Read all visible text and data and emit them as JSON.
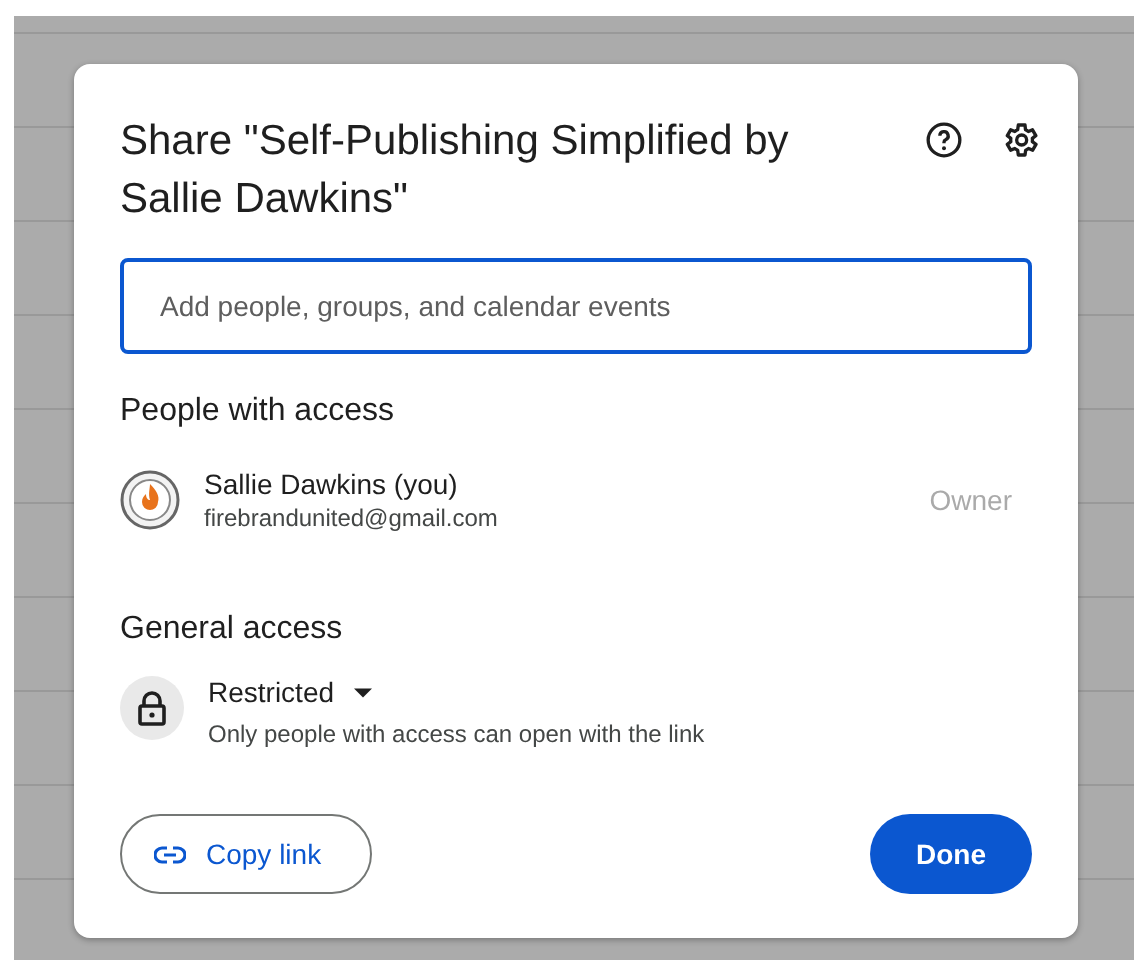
{
  "dialog": {
    "title": "Share \"Self-Publishing Simplified by Sallie Dawkins\""
  },
  "search": {
    "placeholder": "Add people, groups, and calendar events"
  },
  "people_with_access": {
    "heading": "People with access",
    "people": [
      {
        "name": "Sallie Dawkins (you)",
        "email": "firebrandunited@gmail.com",
        "role": "Owner"
      }
    ]
  },
  "general_access": {
    "heading": "General access",
    "setting": "Restricted",
    "description": "Only people with access can open with the link"
  },
  "buttons": {
    "copy_link": "Copy link",
    "done": "Done"
  }
}
